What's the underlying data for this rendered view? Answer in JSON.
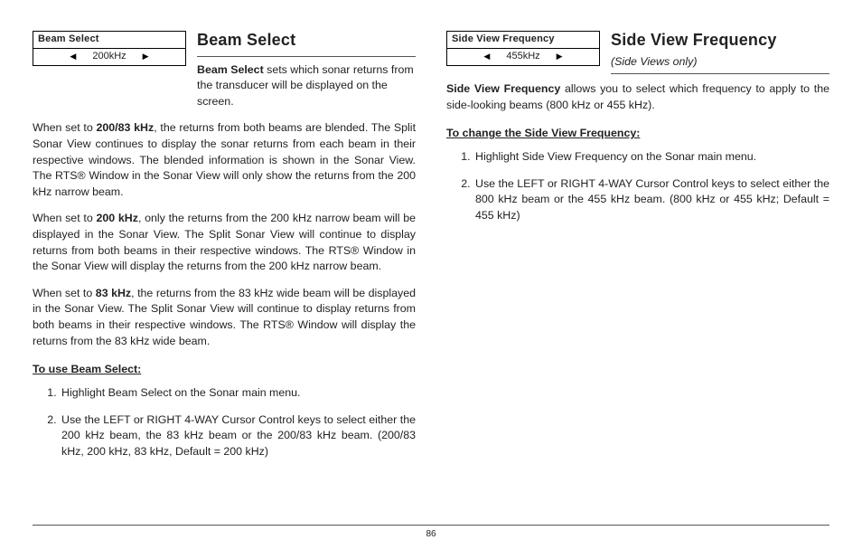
{
  "pageNumber": "86",
  "left": {
    "widget": {
      "title": "Beam Select",
      "value": "200kHz"
    },
    "heading": "Beam Select",
    "introLead": "Beam Select",
    "introRest": " sets which sonar returns from the transducer will be displayed on the screen.",
    "p1_pre": "When set to ",
    "p1_bold": "200/83 kHz",
    "p1_post": ", the returns from both beams are blended. The Split Sonar View continues to display the sonar returns from each beam in their respective windows. The blended information is shown in the Sonar View. The RTS® Window in the Sonar View will only show the returns from the 200 kHz narrow beam.",
    "p2_pre": "When set to ",
    "p2_bold": "200 kHz",
    "p2_post": ", only the returns from the 200 kHz narrow beam will be displayed in the Sonar View. The Split Sonar View will continue to display returns from both beams in their respective windows. The RTS® Window in the Sonar View will display the returns from the 200 kHz narrow beam.",
    "p3_pre": "When set to ",
    "p3_bold": "83 kHz",
    "p3_post": ", the returns from the 83 kHz wide beam will be displayed in the Sonar View. The Split Sonar View will continue to display returns from both beams in their respective windows. The RTS® Window will display the returns from the 83 kHz wide beam.",
    "subhead": "To use Beam Select:",
    "step1": "Highlight Beam Select on the Sonar main menu.",
    "step2": "Use the LEFT or RIGHT 4-WAY Cursor Control keys to select either the 200 kHz beam, the 83 kHz beam or the 200/83 kHz beam. (200/83 kHz, 200 kHz, 83 kHz, Default = 200 kHz)"
  },
  "right": {
    "widget": {
      "title": "Side View Frequency",
      "value": "455kHz"
    },
    "heading": "Side View Frequency",
    "subtitle": "(Side Views only)",
    "introLead": "Side View Frequency",
    "introRest": " allows you to select which frequency to apply to the side-looking beams (800 kHz or 455 kHz).",
    "subhead": "To change the Side View Frequency:",
    "step1": "Highlight Side View Frequency on the Sonar main menu.",
    "step2": "Use the LEFT or RIGHT 4-WAY Cursor Control keys to select either the 800 kHz beam or the 455 kHz beam. (800 kHz or 455 kHz; Default = 455 kHz)"
  }
}
